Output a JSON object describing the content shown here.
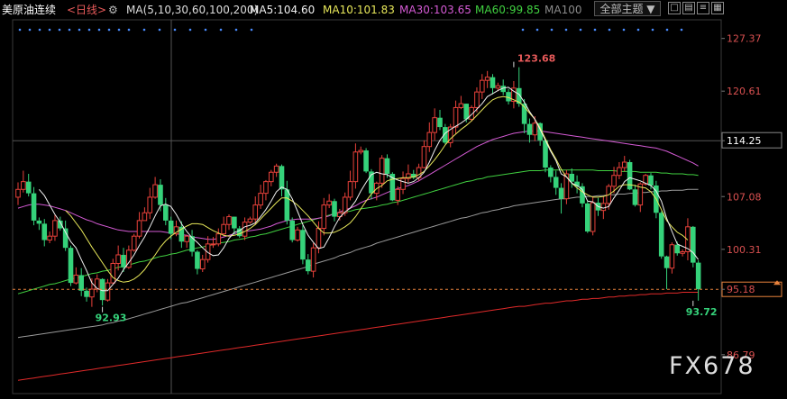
{
  "header": {
    "symbol": "美原油连续",
    "period": "<日线>",
    "ma_params": "MA(5,10,30,60,100,200)",
    "ma5": "MA5:104.60",
    "ma10": "MA10:101.83",
    "ma30": "MA30:103.65",
    "ma60": "MA60:99.85",
    "ma100": "MA100",
    "theme_button": "全部主题",
    "theme_arrow": "▼"
  },
  "colors": {
    "background": "#000000",
    "up": "#e8413a",
    "down": "#35d27a",
    "ma5": "#f0f0f0",
    "ma10": "#e8e85a",
    "ma30": "#d45ad4",
    "ma60": "#40d040",
    "ma100": "#9a9a9a",
    "ma200": "#e02a2a",
    "axis_text": "#d95050",
    "current_line": "#e8823c",
    "header_symbol": "#ffffff",
    "header_period": "#e85a5a"
  },
  "chart_data": {
    "type": "candlestick",
    "y_axis_ticks": [
      127.37,
      120.61,
      114.25,
      107.08,
      100.31,
      95.18,
      86.79
    ],
    "ylim": [
      83.3,
      129.3
    ],
    "current_price": 95.18,
    "crosshair_price": "114.25",
    "annotations": [
      {
        "label": "123.68",
        "price": 123.68,
        "bar": 94,
        "color": "#e85a5a"
      },
      {
        "label": "92.93",
        "price": 92.93,
        "bar": 16,
        "color": "#35d27a"
      },
      {
        "label": "93.72",
        "price": 93.72,
        "bar": 128,
        "color": "#35d27a"
      }
    ],
    "bar_count": 130,
    "close": [
      108.0,
      109.0,
      107.5,
      104.0,
      103.6,
      101.5,
      102.0,
      104.0,
      103.0,
      100.5,
      96.0,
      97.0,
      95.0,
      94.2,
      95.2,
      96.5,
      93.8,
      96.0,
      98.5,
      99.6,
      98.0,
      100.2,
      102.0,
      104.0,
      105.0,
      107.0,
      108.6,
      106.0,
      104.0,
      102.3,
      103.2,
      101.3,
      102.0,
      100.0,
      97.8,
      99.0,
      101.0,
      101.0,
      102.3,
      103.5,
      104.5,
      103.0,
      102.0,
      103.8,
      104.2,
      106.0,
      107.5,
      109.0,
      110.2,
      111.0,
      108.0,
      104.0,
      101.5,
      102.8,
      99.0,
      97.5,
      100.5,
      103.0,
      106.0,
      106.5,
      104.5,
      105.0,
      107.0,
      109.0,
      112.8,
      113.0,
      110.3,
      107.5,
      108.8,
      112.0,
      110.0,
      106.6,
      108.0,
      109.4,
      110.0,
      109.5,
      110.8,
      113.5,
      115.3,
      117.2,
      116.0,
      114.0,
      116.0,
      118.5,
      119.0,
      117.0,
      118.5,
      120.5,
      122.0,
      122.4,
      121.0,
      121.3,
      120.5,
      119.3,
      121.0,
      119.0,
      116.4,
      115.0,
      116.5,
      114.3,
      110.8,
      109.6,
      108.2,
      106.8,
      110.0,
      109.0,
      108.4,
      106.2,
      102.6,
      106.3,
      105.3,
      106.2,
      108.4,
      109.8,
      110.8,
      111.5,
      108.0,
      106.0,
      108.7,
      109.8,
      108.5,
      105.0,
      99.4,
      97.9,
      100.9,
      99.8,
      100.0,
      103.2,
      98.6,
      95.2
    ],
    "open": [
      107.0,
      108.0,
      109.0,
      107.5,
      104.0,
      103.6,
      101.5,
      102.0,
      104.0,
      103.0,
      100.5,
      96.0,
      97.0,
      95.0,
      94.2,
      95.2,
      96.5,
      93.8,
      96.0,
      98.5,
      99.6,
      98.0,
      100.2,
      102.0,
      104.0,
      105.0,
      107.0,
      108.6,
      106.0,
      104.0,
      102.3,
      103.2,
      101.3,
      102.0,
      100.0,
      97.8,
      99.0,
      101.0,
      101.0,
      102.3,
      103.5,
      104.5,
      103.0,
      102.0,
      103.8,
      104.2,
      106.0,
      107.5,
      109.0,
      110.2,
      111.0,
      108.0,
      104.0,
      101.5,
      102.8,
      99.0,
      97.5,
      100.5,
      103.0,
      106.0,
      106.5,
      104.5,
      105.0,
      107.0,
      109.0,
      112.8,
      113.0,
      110.3,
      107.5,
      108.8,
      112.0,
      110.0,
      106.6,
      108.0,
      109.4,
      110.0,
      109.5,
      110.8,
      113.5,
      115.3,
      117.2,
      116.0,
      114.0,
      116.0,
      118.5,
      119.0,
      117.0,
      118.5,
      120.5,
      122.0,
      122.4,
      121.0,
      121.3,
      120.5,
      119.3,
      121.0,
      119.0,
      116.4,
      115.0,
      116.5,
      114.3,
      110.8,
      109.6,
      108.2,
      106.8,
      110.0,
      109.0,
      108.4,
      106.2,
      102.6,
      106.3,
      105.3,
      106.2,
      108.4,
      109.8,
      110.8,
      111.5,
      108.0,
      106.0,
      108.7,
      109.8,
      108.5,
      105.0,
      99.4,
      97.9,
      100.9,
      99.8,
      100.0,
      103.2,
      98.6
    ],
    "high": [
      108.9,
      110.4,
      110.0,
      108.3,
      104.4,
      104.2,
      102.6,
      104.7,
      104.5,
      104.0,
      100.8,
      98.0,
      97.9,
      95.4,
      96.6,
      97.1,
      96.6,
      96.5,
      99.1,
      100.8,
      100.5,
      100.8,
      102.3,
      105.1,
      105.7,
      108.2,
      109.6,
      109.3,
      106.9,
      104.5,
      104.0,
      103.9,
      102.2,
      102.8,
      100.2,
      99.6,
      102.0,
      101.9,
      103.0,
      104.5,
      104.8,
      104.5,
      103.3,
      104.4,
      104.5,
      107.1,
      108.6,
      109.2,
      110.5,
      111.3,
      111.2,
      109.1,
      104.4,
      103.2,
      103.4,
      99.7,
      101.1,
      103.9,
      106.9,
      107.4,
      106.8,
      105.5,
      107.6,
      110.4,
      113.9,
      113.5,
      113.3,
      110.6,
      109.0,
      112.4,
      112.5,
      110.2,
      108.4,
      110.3,
      111.2,
      110.5,
      111.3,
      114.3,
      116.6,
      118.4,
      118.2,
      116.4,
      116.4,
      119.4,
      120.0,
      119.0,
      118.8,
      121.1,
      122.8,
      123.2,
      122.8,
      121.7,
      122.1,
      120.9,
      121.9,
      123.68,
      119.6,
      117.1,
      117.4,
      116.6,
      114.5,
      111.1,
      110.4,
      108.8,
      110.5,
      110.7,
      109.8,
      108.8,
      106.5,
      107.1,
      106.9,
      107.1,
      108.7,
      110.9,
      111.5,
      112.3,
      111.8,
      108.6,
      108.9,
      110.0,
      110.1,
      109.1,
      105.2,
      99.5,
      101.2,
      101.3,
      100.3,
      104.3,
      103.3,
      98.9
    ],
    "low": [
      106.0,
      107.6,
      107.1,
      103.4,
      102.8,
      100.7,
      101.1,
      101.4,
      102.7,
      100.1,
      95.6,
      95.8,
      94.3,
      93.6,
      92.93,
      94.8,
      93.1,
      93.6,
      95.8,
      97.6,
      97.4,
      97.8,
      100.0,
      101.7,
      104.0,
      104.2,
      106.8,
      105.2,
      103.4,
      101.6,
      102.0,
      100.5,
      100.5,
      99.4,
      97.1,
      97.4,
      98.6,
      100.5,
      100.7,
      102.0,
      102.8,
      102.2,
      101.8,
      101.5,
      103.6,
      103.5,
      105.5,
      106.6,
      108.4,
      109.6,
      107.1,
      103.5,
      101.2,
      101.3,
      98.4,
      97.1,
      96.7,
      99.8,
      102.1,
      105.6,
      103.9,
      104.0,
      104.6,
      106.6,
      108.1,
      112.5,
      110.1,
      106.7,
      106.6,
      108.2,
      109.5,
      106.5,
      106.0,
      107.4,
      108.9,
      109.3,
      109.1,
      110.7,
      112.8,
      114.3,
      115.6,
      113.8,
      113.4,
      115.1,
      118.3,
      116.6,
      116.7,
      117.9,
      119.6,
      121.0,
      120.2,
      120.6,
      120.1,
      118.9,
      118.4,
      118.6,
      115.2,
      114.0,
      114.2,
      113.6,
      110.2,
      108.9,
      107.3,
      104.9,
      106.1,
      108.2,
      107.5,
      105.7,
      102.4,
      102.1,
      104.6,
      104.2,
      105.4,
      107.5,
      109.3,
      110.3,
      107.9,
      105.8,
      105.1,
      108.5,
      108.0,
      104.3,
      99.1,
      95.2,
      97.2,
      99.5,
      99.4,
      98.9,
      98.0,
      93.72
    ],
    "ma5": [
      null,
      null,
      null,
      null,
      108.0,
      107.2,
      106.0,
      104.8,
      103.8,
      102.5,
      101.3,
      100.5,
      99.0,
      97.6,
      96.0,
      95.3,
      95.0,
      95.0,
      95.8,
      96.6,
      97.7,
      98.6,
      99.6,
      100.8,
      101.9,
      103.2,
      104.6,
      105.9,
      106.1,
      105.8,
      104.8,
      103.6,
      102.6,
      101.8,
      101.2,
      100.5,
      99.9,
      99.5,
      99.6,
      100.5,
      101.7,
      102.5,
      102.7,
      103.2,
      103.4,
      103.7,
      104.5,
      105.4,
      106.5,
      107.7,
      108.3,
      108.0,
      106.8,
      105.2,
      103.5,
      102.1,
      101.2,
      100.4,
      100.6,
      101.8,
      103.2,
      104.4,
      105.1,
      105.6,
      106.5,
      107.8,
      108.9,
      109.9,
      110.2,
      110.0,
      109.9,
      109.5,
      109.2,
      109.0,
      108.8,
      109.0,
      109.5,
      110.2,
      111.5,
      113.0,
      114.3,
      115.2,
      115.7,
      116.1,
      116.5,
      117.0,
      117.6,
      118.3,
      119.0,
      119.9,
      120.3,
      120.7,
      121.0,
      121.1,
      120.6,
      120.2,
      119.2,
      118.0,
      117.0,
      115.7,
      114.3,
      112.9,
      111.7,
      110.0,
      109.6,
      108.8,
      108.5,
      108.0,
      106.5,
      106.4,
      105.8,
      105.6,
      105.8,
      106.9,
      107.9,
      109.0,
      109.5,
      109.3,
      109.1,
      108.8,
      108.5,
      107.8,
      106.5,
      104.3,
      102.6,
      101.0,
      100.7,
      100.4,
      99.9,
      99.0
    ],
    "ma10": [
      null,
      null,
      null,
      null,
      null,
      null,
      null,
      null,
      null,
      105.3,
      104.6,
      103.7,
      102.8,
      101.7,
      100.6,
      99.6,
      98.6,
      97.6,
      96.7,
      96.3,
      96.1,
      96.2,
      96.5,
      97.0,
      97.7,
      98.7,
      99.6,
      100.6,
      101.4,
      102.0,
      102.5,
      102.9,
      103.3,
      103.6,
      103.6,
      103.5,
      103.1,
      102.7,
      102.4,
      102.1,
      102.0,
      102.1,
      102.3,
      102.6,
      103.0,
      103.5,
      104.2,
      104.9,
      105.6,
      106.3,
      106.9,
      106.9,
      106.5,
      106.0,
      105.3,
      104.6,
      103.8,
      103.0,
      102.4,
      102.4,
      102.5,
      102.8,
      103.2,
      103.7,
      104.5,
      105.5,
      106.5,
      107.4,
      108.1,
      108.5,
      109.1,
      109.3,
      109.4,
      109.5,
      109.5,
      109.6,
      109.9,
      110.3,
      111.0,
      111.8,
      112.7,
      113.7,
      114.5,
      115.1,
      115.7,
      116.2,
      116.8,
      117.5,
      118.2,
      118.9,
      119.5,
      119.8,
      119.9,
      119.8,
      119.5,
      119.2,
      118.6,
      117.8,
      117.0,
      115.9,
      114.5,
      113.1,
      111.9,
      110.6,
      109.6,
      108.8,
      108.2,
      107.7,
      107.3,
      107.0,
      107.0,
      107.1,
      107.3,
      107.8,
      108.4,
      108.6,
      108.6,
      108.5,
      108.3,
      108.2,
      107.7,
      106.8,
      105.4,
      104.0,
      103.2,
      102.5,
      102.1,
      101.5
    ],
    "ma30": [
      105.6,
      105.8,
      106.0,
      106.1,
      106.1,
      106.0,
      105.9,
      105.7,
      105.5,
      105.3,
      105.0,
      104.7,
      104.4,
      104.1,
      103.9,
      103.6,
      103.4,
      103.2,
      103.0,
      102.8,
      102.7,
      102.6,
      102.6,
      102.6,
      102.6,
      102.6,
      102.6,
      102.6,
      102.5,
      102.4,
      102.3,
      102.2,
      102.1,
      101.9,
      101.8,
      101.7,
      101.6,
      101.6,
      101.7,
      101.9,
      102.1,
      102.3,
      102.5,
      102.6,
      102.7,
      102.8,
      102.9,
      103.1,
      103.3,
      103.6,
      103.8,
      104.0,
      104.1,
      104.2,
      104.2,
      104.2,
      104.2,
      104.3,
      104.4,
      104.6,
      104.9,
      105.1,
      105.4,
      105.6,
      105.9,
      106.3,
      106.6,
      106.8,
      107.0,
      107.3,
      107.6,
      107.9,
      108.1,
      108.3,
      108.5,
      108.8,
      109.1,
      109.5,
      109.9,
      110.3,
      110.7,
      111.1,
      111.5,
      111.9,
      112.3,
      112.7,
      113.1,
      113.5,
      113.8,
      114.1,
      114.4,
      114.6,
      114.8,
      115.0,
      115.2,
      115.3,
      115.4,
      115.5,
      115.5,
      115.5,
      115.4,
      115.3,
      115.2,
      115.1,
      115.0,
      114.9,
      114.8,
      114.7,
      114.6,
      114.5,
      114.4,
      114.3,
      114.2,
      114.1,
      114.0,
      113.9,
      113.8,
      113.7,
      113.6,
      113.5,
      113.4,
      113.3,
      113.1,
      112.9,
      112.6,
      112.3,
      112.0,
      111.7,
      111.4,
      111.0
    ],
    "ma60": [
      94.6,
      94.8,
      95.0,
      95.2,
      95.4,
      95.6,
      95.8,
      95.9,
      96.1,
      96.3,
      96.5,
      96.6,
      96.8,
      97.0,
      97.2,
      97.3,
      97.5,
      97.6,
      97.8,
      98.0,
      98.1,
      98.3,
      98.5,
      98.7,
      98.8,
      99.0,
      99.2,
      99.4,
      99.5,
      99.7,
      99.8,
      100.0,
      100.2,
      100.3,
      100.5,
      100.6,
      100.8,
      100.9,
      101.1,
      101.2,
      101.3,
      101.5,
      101.6,
      101.7,
      101.9,
      102.0,
      102.2,
      102.3,
      102.5,
      102.7,
      102.9,
      103.1,
      103.3,
      103.5,
      103.7,
      103.9,
      104.1,
      104.3,
      104.5,
      104.7,
      104.9,
      105.0,
      105.1,
      105.2,
      105.4,
      105.5,
      105.6,
      105.7,
      105.8,
      106.0,
      106.1,
      106.3,
      106.4,
      106.6,
      106.8,
      107.0,
      107.2,
      107.4,
      107.6,
      107.8,
      108.0,
      108.2,
      108.4,
      108.6,
      108.8,
      109.0,
      109.1,
      109.3,
      109.4,
      109.6,
      109.7,
      109.8,
      109.9,
      110.0,
      110.1,
      110.2,
      110.3,
      110.4,
      110.4,
      110.4,
      110.5,
      110.5,
      110.5,
      110.5,
      110.5,
      110.5,
      110.5,
      110.5,
      110.5,
      110.5,
      110.4,
      110.4,
      110.4,
      110.4,
      110.3,
      110.3,
      110.3,
      110.3,
      110.2,
      110.2,
      110.2,
      110.2,
      110.1,
      110.1,
      110.0,
      110.0,
      110.0,
      109.9,
      109.9,
      109.8
    ],
    "ma100": [
      89.0,
      89.1,
      89.2,
      89.3,
      89.4,
      89.5,
      89.6,
      89.7,
      89.8,
      89.9,
      90.0,
      90.1,
      90.2,
      90.3,
      90.4,
      90.5,
      90.6,
      90.8,
      90.9,
      91.1,
      91.2,
      91.4,
      91.6,
      91.8,
      92.0,
      92.2,
      92.4,
      92.6,
      92.8,
      93.0,
      93.2,
      93.4,
      93.5,
      93.7,
      93.9,
      94.1,
      94.3,
      94.5,
      94.7,
      94.9,
      95.1,
      95.3,
      95.5,
      95.7,
      95.9,
      96.1,
      96.3,
      96.5,
      96.7,
      96.9,
      97.1,
      97.3,
      97.5,
      97.7,
      97.9,
      98.1,
      98.4,
      98.6,
      98.8,
      99.0,
      99.2,
      99.5,
      99.7,
      99.9,
      100.2,
      100.4,
      100.6,
      100.8,
      101.1,
      101.3,
      101.5,
      101.7,
      101.9,
      102.1,
      102.3,
      102.5,
      102.7,
      102.9,
      103.1,
      103.3,
      103.5,
      103.7,
      103.9,
      104.1,
      104.3,
      104.4,
      104.6,
      104.8,
      105.0,
      105.1,
      105.3,
      105.4,
      105.6,
      105.7,
      105.9,
      106.0,
      106.1,
      106.2,
      106.3,
      106.4,
      106.5,
      106.6,
      106.7,
      106.8,
      106.8,
      106.9,
      107.0,
      107.0,
      107.1,
      107.1,
      107.2,
      107.2,
      107.3,
      107.3,
      107.4,
      107.4,
      107.5,
      107.5,
      107.6,
      107.6,
      107.7,
      107.7,
      107.8,
      107.8,
      107.9,
      107.9,
      107.9,
      108.0,
      108.0,
      108.0
    ],
    "ma200": [
      83.5,
      83.6,
      83.7,
      83.8,
      83.9,
      84.0,
      84.1,
      84.2,
      84.3,
      84.4,
      84.5,
      84.6,
      84.7,
      84.8,
      84.9,
      85.0,
      85.1,
      85.2,
      85.3,
      85.4,
      85.5,
      85.6,
      85.7,
      85.8,
      85.9,
      86.0,
      86.1,
      86.2,
      86.3,
      86.4,
      86.5,
      86.6,
      86.7,
      86.8,
      86.9,
      87.0,
      87.1,
      87.2,
      87.3,
      87.4,
      87.5,
      87.6,
      87.7,
      87.8,
      87.9,
      88.0,
      88.1,
      88.2,
      88.3,
      88.4,
      88.5,
      88.6,
      88.7,
      88.8,
      88.9,
      89.0,
      89.1,
      89.2,
      89.3,
      89.4,
      89.5,
      89.6,
      89.7,
      89.8,
      89.9,
      90.0,
      90.1,
      90.2,
      90.3,
      90.4,
      90.5,
      90.6,
      90.7,
      90.8,
      90.9,
      91.0,
      91.1,
      91.2,
      91.3,
      91.4,
      91.5,
      91.6,
      91.7,
      91.8,
      91.9,
      92.0,
      92.1,
      92.2,
      92.3,
      92.4,
      92.5,
      92.6,
      92.7,
      92.8,
      92.9,
      93.0,
      93.0,
      93.1,
      93.2,
      93.3,
      93.4,
      93.4,
      93.5,
      93.6,
      93.7,
      93.7,
      93.8,
      93.9,
      93.9,
      94.0,
      94.0,
      94.1,
      94.2,
      94.2,
      94.3,
      94.3,
      94.4,
      94.4,
      94.5,
      94.5,
      94.6,
      94.6,
      94.6,
      94.7,
      94.7,
      94.7,
      94.8,
      94.8,
      94.8,
      94.8
    ]
  },
  "watermark": "FX678"
}
